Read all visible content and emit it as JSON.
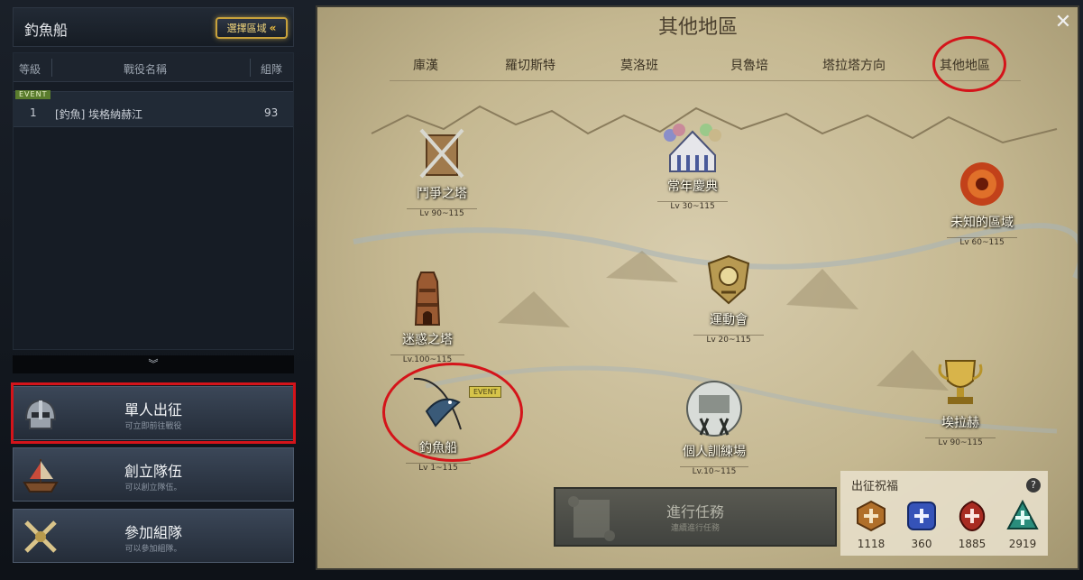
{
  "left_panel": {
    "title": "釣魚船",
    "region_button": "選擇區域",
    "region_button_icon": "«",
    "columns": {
      "grade": "等級",
      "battle_name": "戰役名稱",
      "party": "組隊"
    },
    "rows": [
      {
        "badge": "EVENT",
        "grade": "1",
        "name": "[釣魚] 埃格納赫江",
        "party": "93"
      }
    ],
    "expand_icon": "︾",
    "actions": [
      {
        "label": "單人出征",
        "sub": "可立即前往戰役",
        "icon": "helmet-icon"
      },
      {
        "label": "創立隊伍",
        "sub": "可以創立隊伍。",
        "icon": "ship-icon"
      },
      {
        "label": "參加組隊",
        "sub": "可以參加組隊。",
        "icon": "crossed-swords-icon"
      }
    ]
  },
  "map": {
    "title": "其他地區",
    "close": "✕",
    "tabs": [
      "庫漢",
      "羅切斯特",
      "莫洛班",
      "貝魯培",
      "塔拉塔方向",
      "其他地區"
    ],
    "active_tab": "其他地區",
    "nodes": [
      {
        "name": "鬥爭之塔",
        "lv": "Lv 90~115",
        "icon": "crossed-swords-icon"
      },
      {
        "name": "常年慶典",
        "lv": "Lv 30~115",
        "icon": "circus-tent-icon"
      },
      {
        "name": "未知的區域",
        "lv": "Lv 60~115",
        "icon": "vortex-icon"
      },
      {
        "name": "迷惑之塔",
        "lv": "Lv.100~115",
        "icon": "tower-icon"
      },
      {
        "name": "運動會",
        "lv": "Lv 20~115",
        "icon": "trophy-shield-icon"
      },
      {
        "name": "釣魚船",
        "lv": "Lv 1~115",
        "icon": "fishing-icon",
        "badge": "EVENT"
      },
      {
        "name": "個人訓練場",
        "lv": "Lv.10~115",
        "icon": "training-ground-icon"
      },
      {
        "name": "埃拉赫",
        "lv": "Lv 90~115",
        "icon": "golden-trophy-icon"
      }
    ],
    "task_button": {
      "label": "進行任務",
      "sub": "連續進行任務"
    },
    "blessing": {
      "title": "出征祝福",
      "help": "?",
      "items": [
        {
          "value": "1118",
          "color": "#b06f2a"
        },
        {
          "value": "360",
          "color": "#3553b8"
        },
        {
          "value": "1885",
          "color": "#a82b22"
        },
        {
          "value": "2919",
          "color": "#2a8d7c"
        }
      ]
    }
  }
}
